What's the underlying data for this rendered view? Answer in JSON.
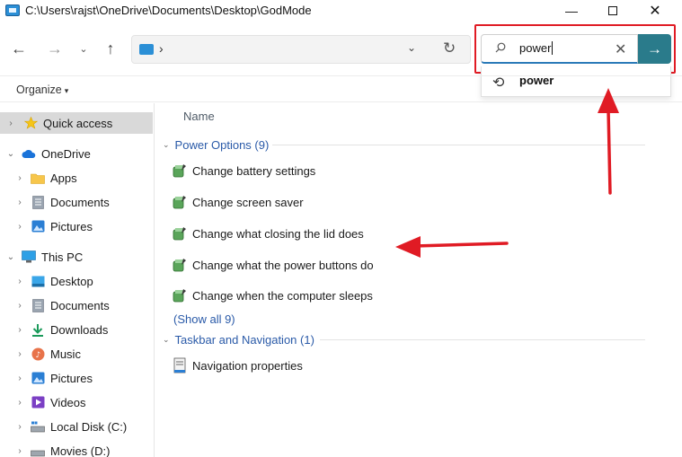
{
  "window": {
    "title": "C:\\Users\\rajst\\OneDrive\\Documents\\Desktop\\GodMode",
    "minimize": "—",
    "close": "✕"
  },
  "nav": {
    "back": "←",
    "forward": "→",
    "recent": "⌄",
    "up": "↑",
    "address_separator": "›",
    "address_dropdown": "⌄",
    "refresh": "↻"
  },
  "search": {
    "value": "power",
    "clear": "✕",
    "go": "→",
    "suggestion": "power"
  },
  "toolbar": {
    "organize": "Organize",
    "organize_caret": "▾"
  },
  "sidebar": {
    "items": [
      {
        "label": "Quick access",
        "icon": "star-icon"
      },
      {
        "label": "OneDrive",
        "icon": "cloud-icon"
      },
      {
        "label": "Apps",
        "icon": "folder-icon"
      },
      {
        "label": "Documents",
        "icon": "documents-icon"
      },
      {
        "label": "Pictures",
        "icon": "pictures-icon"
      },
      {
        "label": "This PC",
        "icon": "computer-icon"
      },
      {
        "label": "Desktop",
        "icon": "desktop-icon"
      },
      {
        "label": "Documents",
        "icon": "documents-icon"
      },
      {
        "label": "Downloads",
        "icon": "download-icon"
      },
      {
        "label": "Music",
        "icon": "music-icon"
      },
      {
        "label": "Pictures",
        "icon": "pictures-icon"
      },
      {
        "label": "Videos",
        "icon": "videos-icon"
      },
      {
        "label": "Local Disk (C:)",
        "icon": "drive-icon"
      },
      {
        "label": "Movies (D:)",
        "icon": "drive-icon"
      }
    ]
  },
  "main": {
    "column_name": "Name",
    "groups": [
      {
        "title": "Power Options (9)",
        "items": [
          "Change battery settings",
          "Change screen saver",
          "Change what closing the lid does",
          "Change what the power buttons do",
          "Change when the computer sleeps"
        ],
        "show_all": "(Show all 9)"
      },
      {
        "title": "Taskbar and Navigation (1)",
        "items": [
          "Navigation properties"
        ]
      }
    ]
  },
  "colors": {
    "annotation_red": "#e01b24",
    "search_go": "#2a7b8b",
    "group_header": "#2a5aa8",
    "selection": "#d9d9d9"
  }
}
